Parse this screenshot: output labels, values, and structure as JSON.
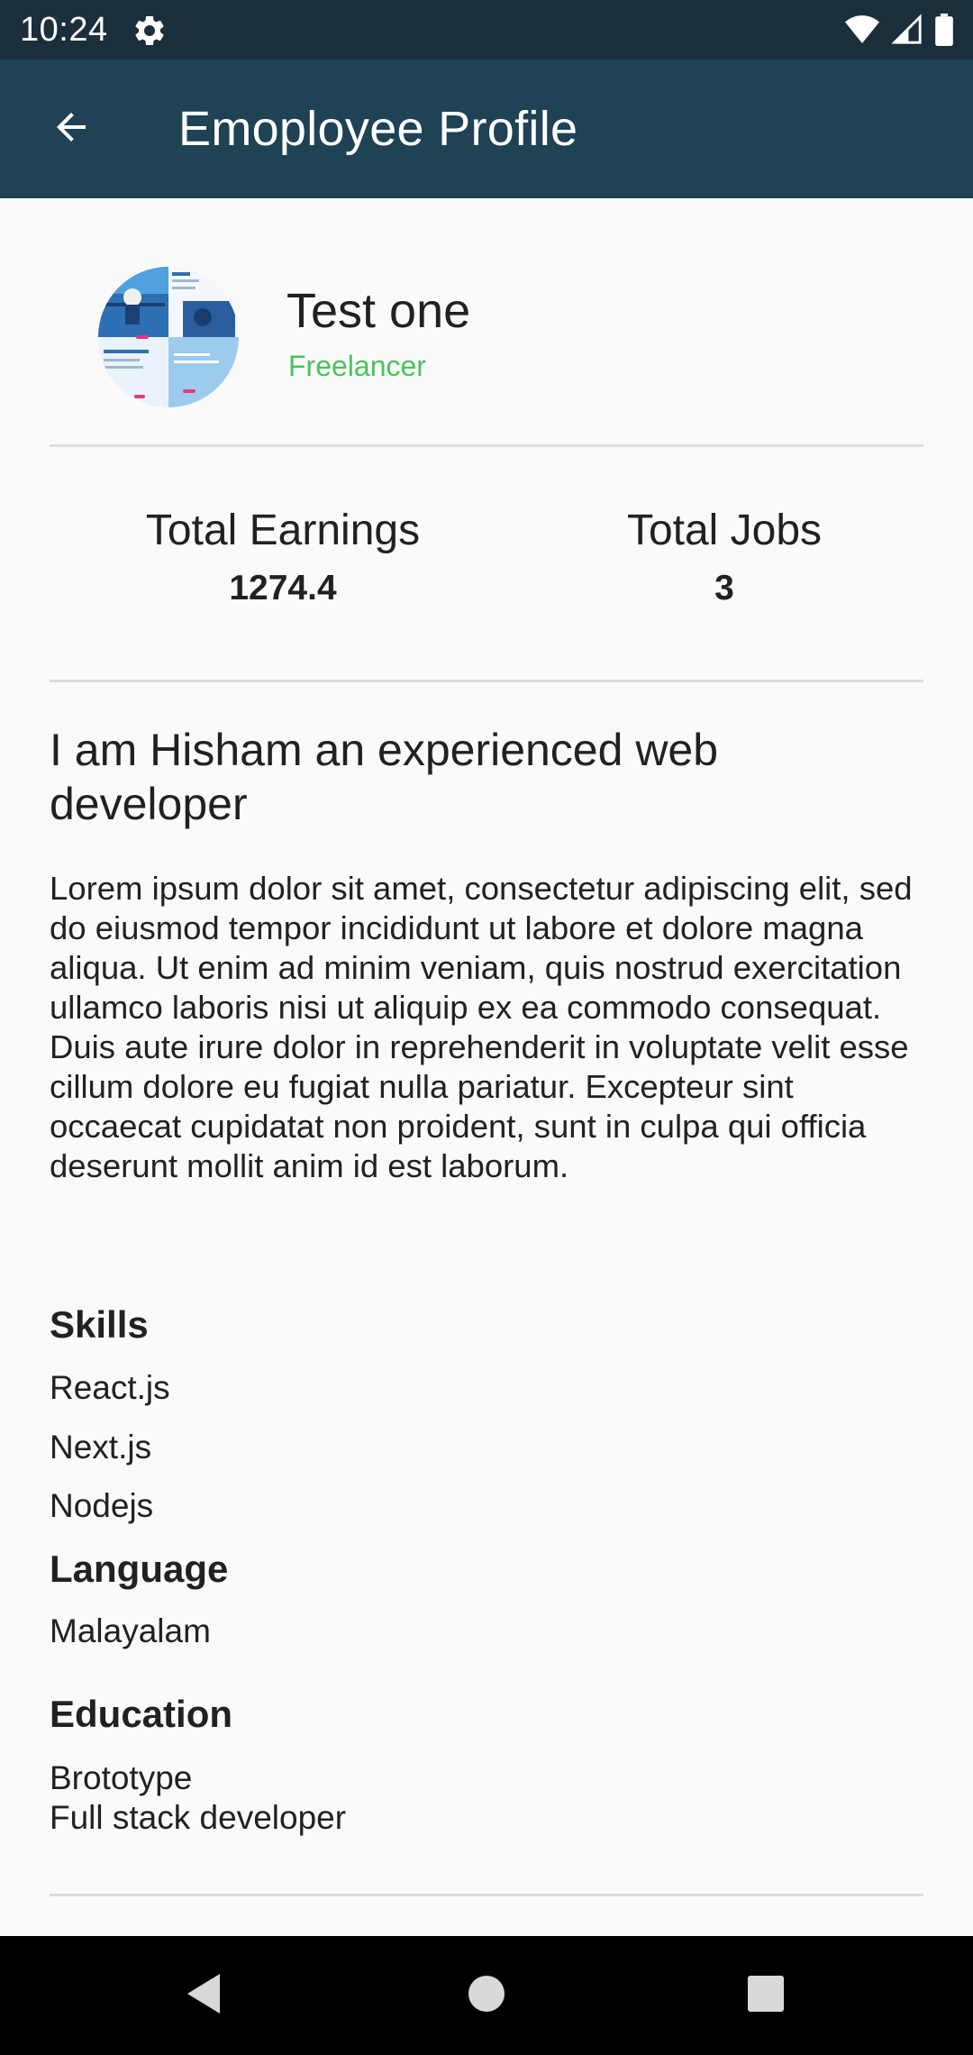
{
  "status_bar": {
    "time": "10:24",
    "icons": [
      "gear-icon",
      "wifi-icon",
      "signal-icon",
      "battery-icon"
    ]
  },
  "app_bar": {
    "title": "Emoployee Profile",
    "back_icon": "arrow-back-icon"
  },
  "profile": {
    "name": "Test one",
    "role": "Freelancer",
    "role_color": "#4CC25C"
  },
  "stats": {
    "earnings_label": "Total Earnings",
    "earnings_value": "1274.4",
    "jobs_label": "Total Jobs",
    "jobs_value": "3"
  },
  "bio": {
    "title": "I am Hisham an experienced web developer",
    "text": "Lorem ipsum dolor sit amet, consectetur adipiscing elit, sed do eiusmod tempor incididunt ut labore et dolore magna aliqua. Ut enim ad minim veniam, quis nostrud exercitation ullamco laboris nisi ut aliquip ex ea commodo consequat. Duis aute irure dolor in reprehenderit in voluptate velit esse cillum dolore eu fugiat nulla pariatur. Excepteur sint occaecat cupidatat non proident, sunt in culpa qui officia deserunt mollit anim id est laborum."
  },
  "skills": {
    "heading": "Skills",
    "items": [
      "React.js",
      "Next.js",
      "Nodejs"
    ]
  },
  "language": {
    "heading": "Language",
    "items": [
      "Malayalam"
    ]
  },
  "education": {
    "heading": "Education",
    "institution": "Brototype",
    "course": "Full stack developer"
  },
  "nav_bar": {
    "icons": [
      "back-triangle-icon",
      "home-circle-icon",
      "recents-square-icon"
    ]
  },
  "colors": {
    "status_bar": "#1B2E3C",
    "app_bar": "#1F4255",
    "background": "#FAFAFA",
    "accent_green": "#4CC25C"
  }
}
